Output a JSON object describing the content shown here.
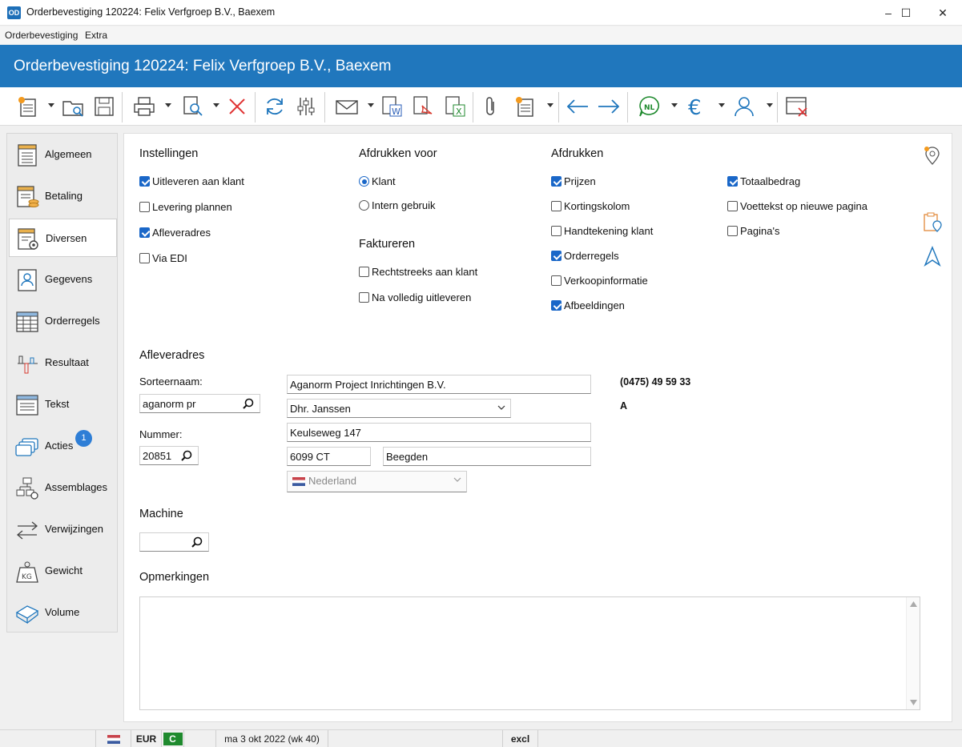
{
  "window": {
    "app_icon": "OD",
    "title": "Orderbevestiging 120224: Felix Verfgroep B.V., Baexem",
    "minimize": "–",
    "maximize": "☐",
    "close": "✕"
  },
  "menu": [
    "Orderbevestiging",
    "Extra"
  ],
  "header": {
    "title": "Orderbevestiging 120224: Felix Verfgroep B.V., Baexem"
  },
  "toolbar": {
    "icons": [
      "new-document-icon",
      "open-folder-search-icon",
      "save-icon",
      "print-icon",
      "print-preview-icon",
      "delete-icon",
      "refresh-icon",
      "settings-sliders-icon",
      "email-icon",
      "export-word-icon",
      "export-pdf-icon",
      "export-excel-icon",
      "attachment-icon",
      "new-item-icon",
      "back-arrow-icon",
      "forward-arrow-icon",
      "language-icon",
      "currency-icon",
      "user-icon",
      "close-window-icon"
    ],
    "language_label": "NL",
    "currency_label": "€"
  },
  "sidebar": {
    "items": [
      {
        "label": "Algemeen",
        "icon": "general-form-icon"
      },
      {
        "label": "Betaling",
        "icon": "payment-icon"
      },
      {
        "label": "Diversen",
        "icon": "misc-settings-icon",
        "active": true
      },
      {
        "label": "Gegevens",
        "icon": "contact-card-icon"
      },
      {
        "label": "Orderregels",
        "icon": "table-grid-icon"
      },
      {
        "label": "Resultaat",
        "icon": "result-chart-icon"
      },
      {
        "label": "Tekst",
        "icon": "text-lines-icon"
      },
      {
        "label": "Acties",
        "icon": "actions-stack-icon",
        "badge": "1"
      },
      {
        "label": "Assemblages",
        "icon": "assembly-tree-icon"
      },
      {
        "label": "Verwijzingen",
        "icon": "swap-arrows-icon"
      },
      {
        "label": "Gewicht",
        "icon": "weight-kg-icon"
      },
      {
        "label": "Volume",
        "icon": "volume-box-icon"
      }
    ]
  },
  "instellingen": {
    "heading": "Instellingen",
    "options": [
      {
        "label": "Uitleveren aan klant",
        "checked": true
      },
      {
        "label": "Levering plannen",
        "checked": false
      },
      {
        "label": "Afleveradres",
        "checked": true
      },
      {
        "label": "Via EDI",
        "checked": false
      }
    ]
  },
  "afdrukken_voor": {
    "heading": "Afdrukken voor",
    "options": [
      {
        "label": "Klant",
        "selected": true
      },
      {
        "label": "Intern gebruik",
        "selected": false
      }
    ]
  },
  "factureren": {
    "heading": "Faktureren",
    "options": [
      {
        "label": "Rechtstreeks aan klant",
        "checked": false
      },
      {
        "label": "Na volledig uitleveren",
        "checked": false
      }
    ]
  },
  "afdrukken": {
    "heading": "Afdrukken",
    "col1": [
      {
        "label": "Prijzen",
        "checked": true
      },
      {
        "label": "Kortingskolom",
        "checked": false
      },
      {
        "label": "Handtekening klant",
        "checked": false
      },
      {
        "label": "Orderregels",
        "checked": true
      },
      {
        "label": "Verkoopinformatie",
        "checked": false
      },
      {
        "label": "Afbeeldingen",
        "checked": true
      }
    ],
    "col2": [
      {
        "label": "Totaalbedrag",
        "checked": true
      },
      {
        "label": "Voettekst op nieuwe pagina",
        "checked": false
      },
      {
        "label": "Pagina's",
        "checked": false
      }
    ]
  },
  "afleveradres": {
    "heading": "Afleveradres",
    "sorteernaam_label": "Sorteernaam:",
    "sorteernaam_value": "aganorm pr",
    "nummer_label": "Nummer:",
    "nummer_value": "20851",
    "company": "Aganorm Project Inrichtingen B.V.",
    "contact": "Dhr. Janssen",
    "street": "Keulseweg 147",
    "postcode": "6099 CT",
    "city": "Beegden",
    "country": "Nederland",
    "phone": "(0475) 49 59 33",
    "code": "A"
  },
  "machine": {
    "heading": "Machine",
    "value": ""
  },
  "opmerkingen": {
    "heading": "Opmerkingen",
    "value": ""
  },
  "status": {
    "currency": "EUR",
    "code": "C",
    "date": "ma 3 okt 2022 (wk 40)",
    "mode": "excl"
  },
  "colors": {
    "header_blue": "#2077bd",
    "check_blue": "#1a67c8",
    "badge_blue": "#2e7ed6",
    "status_green": "#1f8a2e"
  }
}
